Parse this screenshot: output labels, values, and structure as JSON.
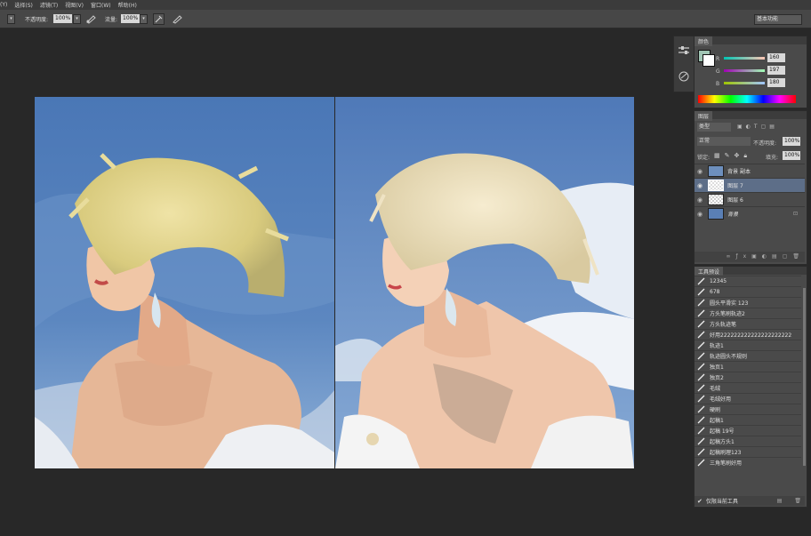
{
  "menu": [
    "(Y)",
    "选择(S)",
    "滤镜(T)",
    "视图(V)",
    "窗口(W)",
    "帮助(H)"
  ],
  "options": {
    "opacity_label": "不透明度:",
    "opacity_value": "100%",
    "flow_label": "流量:",
    "flow_value": "100%",
    "workspace": "基本功能"
  },
  "color_panel": {
    "tab": "颜色",
    "r_label": "R",
    "r_value": "160",
    "g_label": "G",
    "g_value": "197",
    "b_label": "B",
    "b_value": "180",
    "fg_color": "#a0c5b4"
  },
  "layers_panel": {
    "tab": "图层",
    "kind": "类型",
    "blend_mode": "正常",
    "opacity_label": "不透明度:",
    "opacity_value": "100%",
    "lock_label": "锁定:",
    "fill_label": "填充:",
    "fill_value": "100%",
    "layers": [
      {
        "name": "背景 副本",
        "selected": false
      },
      {
        "name": "图层 7",
        "selected": true
      },
      {
        "name": "图层 6",
        "selected": false
      },
      {
        "name": "背景",
        "selected": false
      }
    ]
  },
  "tool_presets": {
    "tab": "工具预设",
    "items": [
      "12345",
      "678",
      "圆头平滑实 123",
      "方头笔刷轨迹2",
      "方头轨迹笔",
      "好用222222222222222222222",
      "轨迹1",
      "轨迹圆头不规则",
      "独页1",
      "独页2",
      "毛绒",
      "毛绒好用",
      "硬刷",
      "起稿1",
      "起稿 19号",
      "起稿方头1",
      "起稿刷理123",
      "三角笔刷好用"
    ],
    "current_only_label": "仅限当前工具"
  }
}
